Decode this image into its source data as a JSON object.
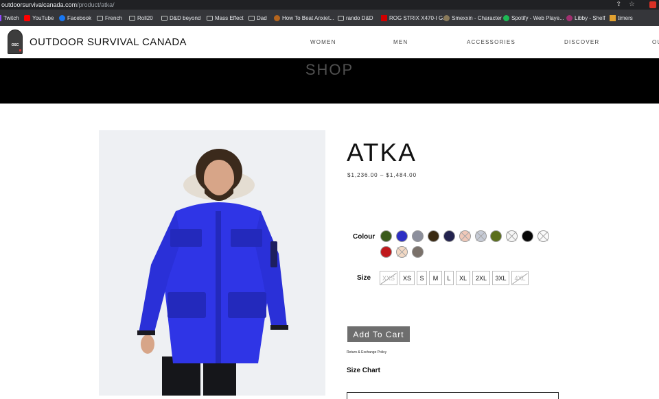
{
  "browser": {
    "url_host": "outdoorsurvivalcanada.com",
    "url_path": "/product/atka/"
  },
  "bookmarks": [
    {
      "label": "Twitch",
      "icon": "twitch-icon",
      "color": "#9146ff"
    },
    {
      "label": "YouTube",
      "icon": "youtube-icon",
      "color": "#ff0000"
    },
    {
      "label": "Facebook",
      "icon": "facebook-icon",
      "color": "#1877f2"
    },
    {
      "label": "French",
      "icon": "folder-icon"
    },
    {
      "label": "Roll20",
      "icon": "folder-icon"
    },
    {
      "label": "D&D beyond",
      "icon": "folder-icon"
    },
    {
      "label": "Mass Effect",
      "icon": "folder-icon"
    },
    {
      "label": "Dad",
      "icon": "folder-icon"
    },
    {
      "label": "How To Beat Anxiet...",
      "icon": "page-icon",
      "color": "#b5651d"
    },
    {
      "label": "rando D&D",
      "icon": "folder-icon"
    },
    {
      "label": "ROG STRIX X470-I G...",
      "icon": "rog-icon",
      "color": "#d00000"
    },
    {
      "label": "Smexxin - Character",
      "icon": "page-icon",
      "color": "#8a7a5a"
    },
    {
      "label": "Spotify - Web Playe...",
      "icon": "spotify-icon",
      "color": "#1db954"
    },
    {
      "label": "Libby - Shelf",
      "icon": "libby-icon",
      "color": "#a03070"
    },
    {
      "label": "timers",
      "icon": "timer-icon",
      "color": "#e0a030"
    }
  ],
  "site": {
    "logo_text": "OSC",
    "brand": "OUTDOOR SURVIVAL CANADA",
    "nav": [
      "WOMEN",
      "MEN",
      "ACCESSORIES",
      "DISCOVER",
      "OU"
    ]
  },
  "banner": {
    "title": "SHOP"
  },
  "product": {
    "title": "ATKA",
    "price": "$1,236.00 – $1,484.00",
    "colour_label": "Colour",
    "colours": [
      {
        "hex": "#3a5a1c",
        "available": true
      },
      {
        "hex": "#2d2fc4",
        "available": true
      },
      {
        "hex": "#8c8f9c",
        "available": true
      },
      {
        "hex": "#3a2a12",
        "available": true
      },
      {
        "hex": "#22224e",
        "available": true
      },
      {
        "hex": "#f0c8b8",
        "available": false
      },
      {
        "hex": "#c6cbd6",
        "available": false
      },
      {
        "hex": "#5a6e1c",
        "available": true
      },
      {
        "hex": "#f6f6f6",
        "available": false
      },
      {
        "hex": "#070707",
        "available": true
      },
      {
        "hex": "#fafafa",
        "available": false
      },
      {
        "hex": "#c0191c",
        "available": true
      },
      {
        "hex": "#f3d9c4",
        "available": false
      },
      {
        "hex": "#7a716a",
        "available": true
      }
    ],
    "size_label": "Size",
    "sizes": [
      {
        "label": "XXS",
        "available": false
      },
      {
        "label": "XS",
        "available": true
      },
      {
        "label": "S",
        "available": true
      },
      {
        "label": "M",
        "available": true
      },
      {
        "label": "L",
        "available": true
      },
      {
        "label": "XL",
        "available": true
      },
      {
        "label": "2XL",
        "available": true
      },
      {
        "label": "3XL",
        "available": true
      },
      {
        "label": "4XL",
        "available": false
      }
    ],
    "add_to_cart": "Add To Cart",
    "return_policy": "Return & Exchange Policy",
    "size_chart": "Size Chart"
  }
}
